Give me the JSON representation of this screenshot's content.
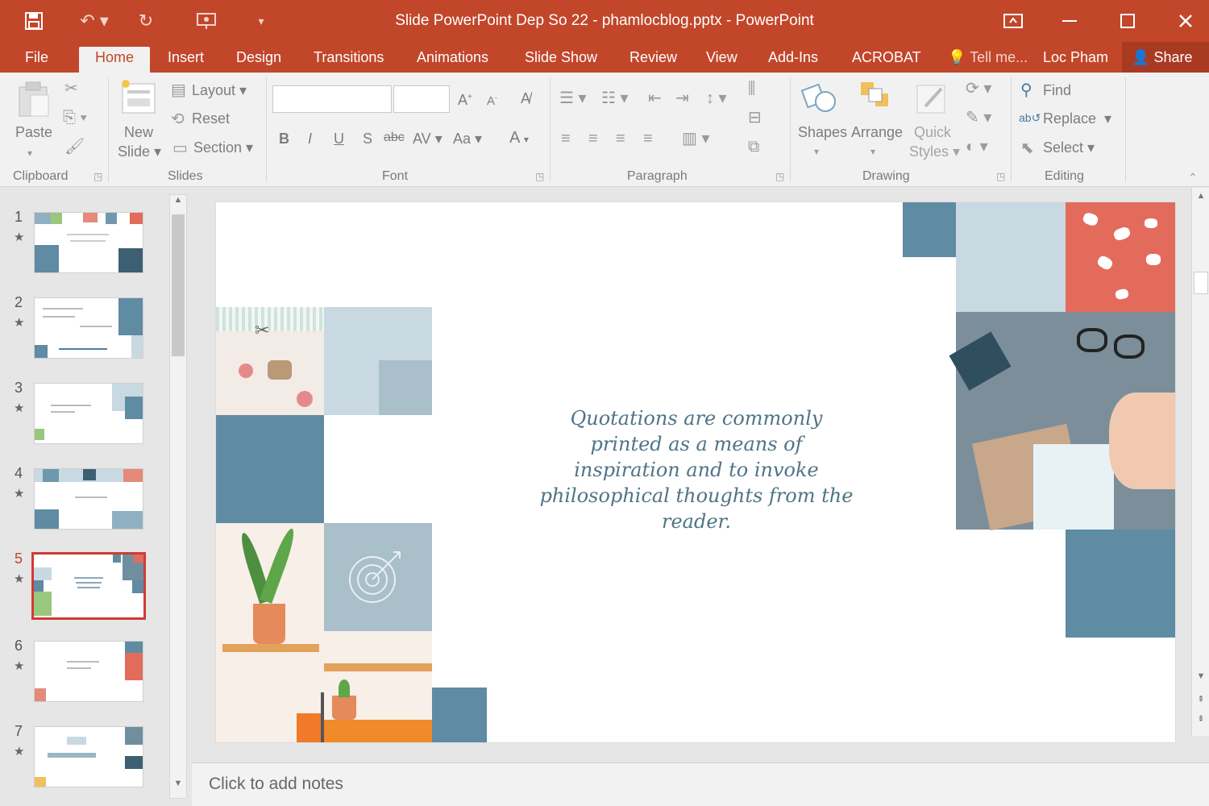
{
  "window": {
    "title": "Slide PowerPoint Dep So 22 - phamlocblog.pptx - PowerPoint",
    "icons": [
      "save-icon",
      "undo-icon",
      "redo-icon",
      "presentation-icon",
      "customize-qat-icon",
      "ribbon-display-icon",
      "minimize-icon",
      "maximize-icon",
      "close-icon"
    ]
  },
  "tabs": {
    "file": "File",
    "home": "Home",
    "insert": "Insert",
    "design": "Design",
    "transitions": "Transitions",
    "animations": "Animations",
    "slideshow": "Slide Show",
    "review": "Review",
    "view": "View",
    "addins": "Add-Ins",
    "acrobat": "ACROBAT",
    "tellme": "Tell me...",
    "user": "Loc Pham",
    "share": "Share"
  },
  "ribbon": {
    "clipboard": {
      "label": "Clipboard",
      "paste": "Paste"
    },
    "slides": {
      "label": "Slides",
      "new_slide_line1": "New",
      "new_slide_line2": "Slide",
      "layout": "Layout",
      "reset": "Reset",
      "section": "Section"
    },
    "font": {
      "label": "Font",
      "bold": "B",
      "italic": "I",
      "underline": "U",
      "shadow": "S",
      "strike": "abc",
      "spacing": "AV",
      "case": "Aa",
      "color": "A"
    },
    "paragraph": {
      "label": "Paragraph"
    },
    "drawing": {
      "label": "Drawing",
      "shapes": "Shapes",
      "arrange": "Arrange",
      "quick_styles_line1": "Quick",
      "quick_styles_line2": "Styles"
    },
    "editing": {
      "label": "Editing",
      "find": "Find",
      "replace": "Replace",
      "select": "Select"
    }
  },
  "slides": [
    {
      "number": "1"
    },
    {
      "number": "2"
    },
    {
      "number": "3"
    },
    {
      "number": "4"
    },
    {
      "number": "5"
    },
    {
      "number": "6"
    },
    {
      "number": "7"
    }
  ],
  "selected_slide": "5",
  "slide": {
    "quote": "Quotations are commonly printed as a means of inspiration and to invoke philosophical thoughts from the reader."
  },
  "notes": {
    "placeholder": "Click to add notes"
  },
  "colors": {
    "accent": "#c2462a",
    "slide_blue": "#5f8ba3",
    "slide_light": "#c9d9e1",
    "slide_coral": "#e46c5b",
    "quote_text": "#4f7487"
  }
}
